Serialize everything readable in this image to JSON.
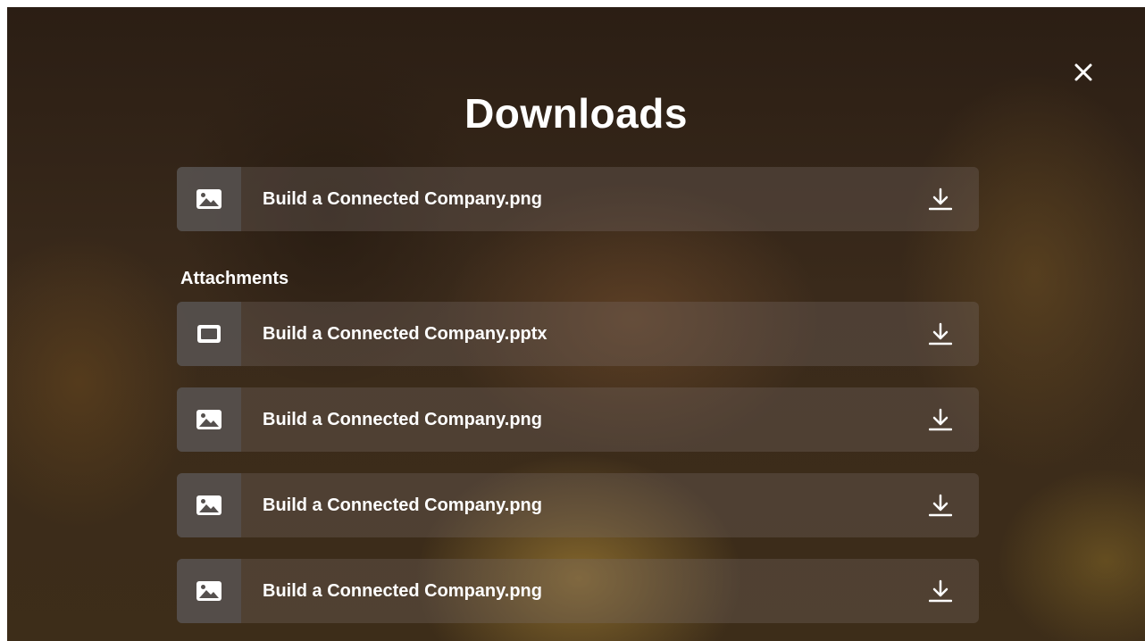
{
  "header": {
    "title": "Downloads"
  },
  "primary_file": {
    "name": "Build a Connected Company.png",
    "type_icon": "image-icon",
    "action_icon": "download-icon"
  },
  "attachments": {
    "label": "Attachments",
    "items": [
      {
        "name": "Build a Connected Company.pptx",
        "type_icon": "presentation-icon",
        "action_icon": "download-icon"
      },
      {
        "name": "Build a Connected Company.png",
        "type_icon": "image-icon",
        "action_icon": "download-icon"
      },
      {
        "name": "Build a Connected Company.png",
        "type_icon": "image-icon",
        "action_icon": "download-icon"
      },
      {
        "name": "Build a Connected Company.png",
        "type_icon": "image-icon",
        "action_icon": "download-icon"
      }
    ]
  },
  "controls": {
    "close_icon": "close-icon"
  },
  "colors": {
    "text": "#ffffff",
    "row_background": "#78706b",
    "icon_panel": "#55504e"
  }
}
